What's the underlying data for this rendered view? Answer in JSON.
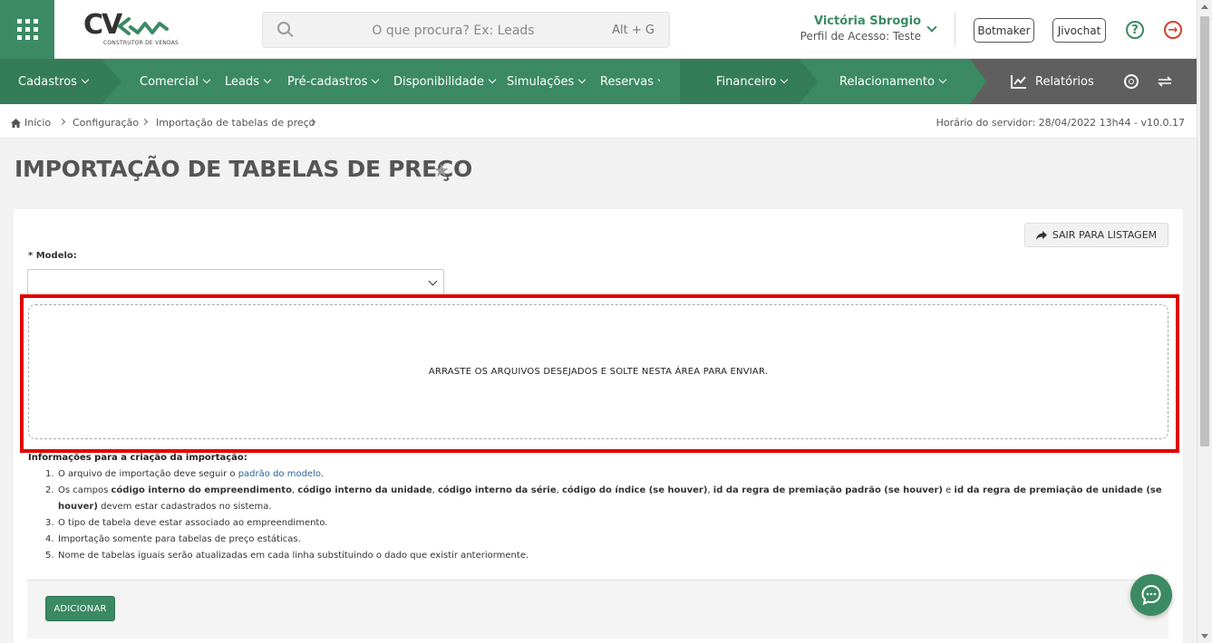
{
  "header": {
    "logo_text": "CV",
    "logo_tagline": "CONSTRUTOR DE VENDAS",
    "search_placeholder": "O que procura? Ex: Leads",
    "search_shortcut": "Alt + G",
    "user_name": "Victória Sbrogio",
    "user_profile": "Perfil de Acesso: Teste",
    "botmaker_label": "Botmaker",
    "jivochat_label": "Jivochat",
    "help_glyph": "?",
    "logout_glyph": "→"
  },
  "nav": {
    "items": [
      {
        "label": "Cadastros"
      },
      {
        "label": "Comercial"
      },
      {
        "label": "Leads"
      },
      {
        "label": "Pré-cadastros"
      },
      {
        "label": "Disponibilidade"
      },
      {
        "label": "Simulações"
      },
      {
        "label": "Reservas"
      },
      {
        "label": "Financeiro"
      },
      {
        "label": "Relacionamento"
      }
    ],
    "reports_label": "Relatórios",
    "colors": {
      "primary": "#3b8a63",
      "dark": "#357d59",
      "gray": "#5f5f5f"
    }
  },
  "breadcrumb": {
    "items": [
      "Início",
      "Configuração",
      "Importação de tabelas de preço"
    ],
    "server_time": "Horário do servidor: 28/04/2022 13h44 - v10.0.17"
  },
  "page": {
    "title": "IMPORTAÇÃO DE TABELAS DE PREÇO",
    "exit_button": "SAIR PARA LISTAGEM",
    "model_label": "* Modelo:",
    "model_value": "",
    "dropzone_text": "ARRASTE OS ARQUIVOS DESEJADOS E SOLTE NESTA ÁREA PARA ENVIAR.",
    "info_title": "Informações para a criação da importação:",
    "info": {
      "i1_num": "1.",
      "i1_text": "O arquivo de importação deve seguir o ",
      "i1_link": "padrão do modelo",
      "i1_end": ".",
      "i2_num": "2.",
      "i2_a": "Os campos ",
      "i2_b": "código interno do empreendimento",
      "i2_c": ", ",
      "i2_d": "código interno da unidade",
      "i2_e": ", ",
      "i2_f": "código interno da série",
      "i2_g": ", ",
      "i2_h": "código do índice (se houver)",
      "i2_i": ", ",
      "i2_j": "id da regra de premiação padrão (se houver)",
      "i2_k": " e ",
      "i2_l": "id da regra de premiação de unidade (se",
      "i2_m": "houver)",
      "i2_n": " devem estar cadastrados no sistema.",
      "i3_num": "3.",
      "i3_text": "O tipo de tabela deve estar associado ao empreendimento.",
      "i4_num": "4.",
      "i4_text": "Importação somente para tabelas de preço estáticas.",
      "i5_num": "5.",
      "i5_text": "Nome de tabelas iguais serão atualizadas em cada linha substituindo o dado que existir anteriormente."
    },
    "add_button": "ADICIONAR"
  }
}
